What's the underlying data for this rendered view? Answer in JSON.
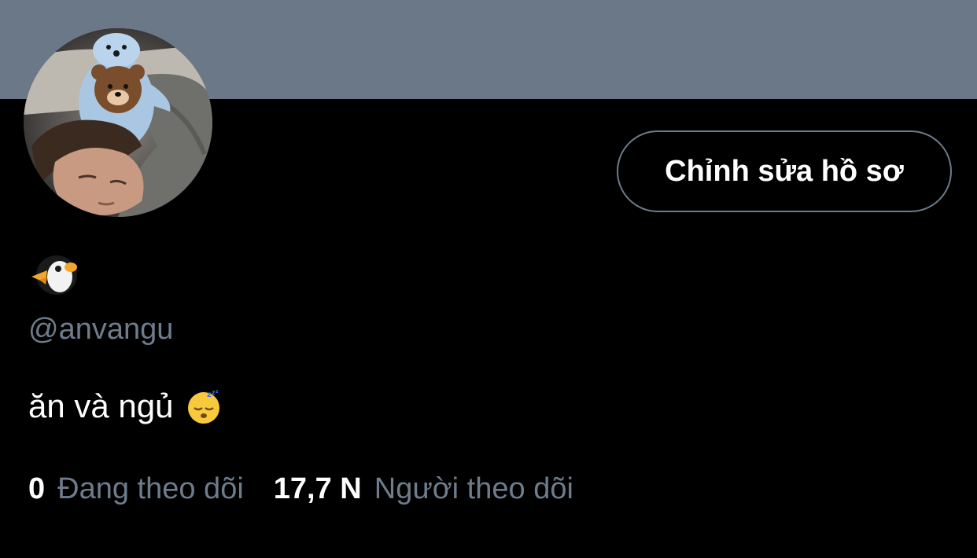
{
  "colors": {
    "banner": "#6a7888",
    "background": "#000000",
    "text_primary": "#ffffff",
    "text_secondary": "#6e7c8c",
    "button_border": "#6d7b8a"
  },
  "profile": {
    "display_name_icon": "penguin-emoji",
    "handle": "@anvangu",
    "bio_text": "ăn và ngủ",
    "bio_icon": "sleeping-face-emoji"
  },
  "actions": {
    "edit_profile_label": "Chỉnh sửa hồ sơ"
  },
  "stats": {
    "following_count": "0",
    "following_label": "Đang theo dõi",
    "followers_count": "17,7 N",
    "followers_label": "Người theo dõi"
  }
}
